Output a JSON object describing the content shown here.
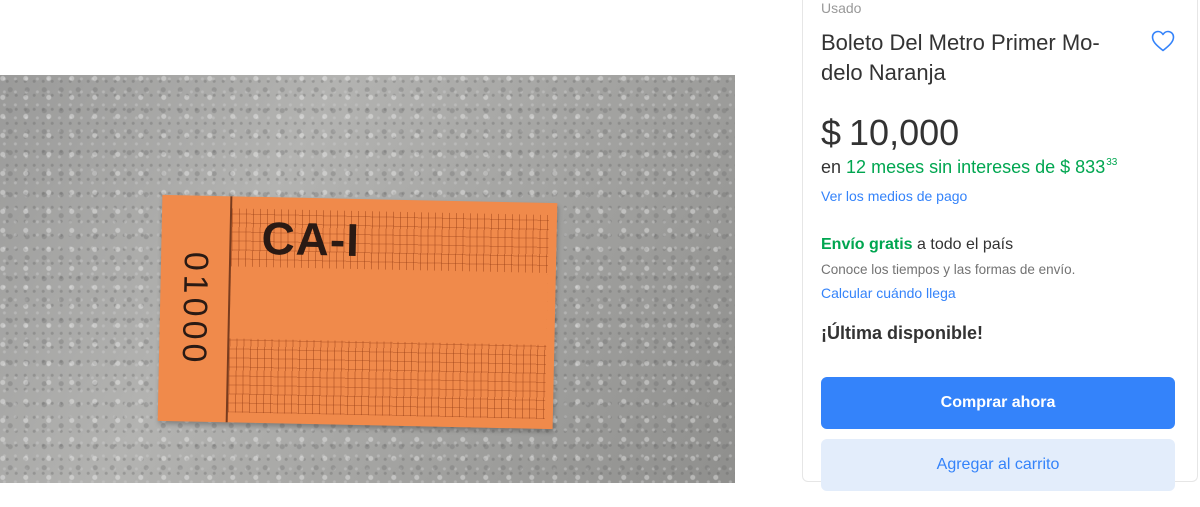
{
  "photo": {
    "ticket_code": "CA-I",
    "ticket_serial": "01000"
  },
  "product": {
    "condition": "Usado",
    "title": "Boleto Del Metro Primer Mo-delo Naranja",
    "favorite_icon": "heart-icon"
  },
  "price": {
    "currency": "$",
    "amount": "10,000"
  },
  "installments": {
    "prefix": "en",
    "months_text": "12 meses sin intereses de $ 833",
    "cents": "33"
  },
  "payment_link": "Ver los medios de pago",
  "shipping": {
    "free_label": "Envío gratis",
    "scope": "a todo el país",
    "note": "Conoce los tiempos y las formas de envío.",
    "calc_link": "Calcular cuándo llega"
  },
  "stock": "¡Última disponible!",
  "buttons": {
    "buy": "Comprar ahora",
    "cart": "Agregar al carrito"
  },
  "colors": {
    "accent": "#3483fa",
    "green": "#00a650",
    "ticket_orange": "#f08a4b"
  }
}
